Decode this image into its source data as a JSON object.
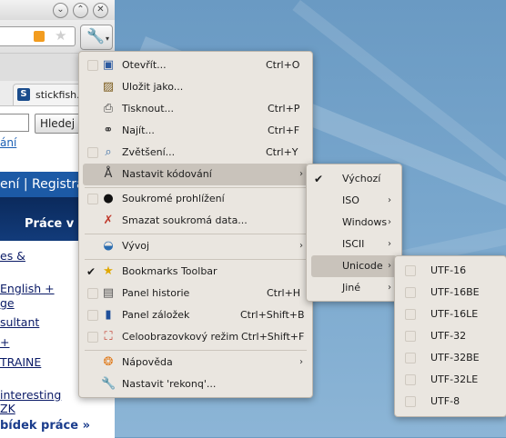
{
  "browser": {
    "tab_label": "stickfish.c",
    "tab_favicon": "S",
    "search_button": "Hledej",
    "link1": "ání",
    "band_text": "ení | Registrac",
    "dark_heading": "Práce v l",
    "jobs": [
      "es &",
      "English +",
      "ge",
      "sultant",
      "+",
      "TRAINE",
      "interesting",
      "ZK"
    ],
    "more_link": "bídek práce »"
  },
  "main_menu": {
    "items": [
      {
        "icon": "folder-open-icon",
        "label": "Otevřít...",
        "shortcut": "Ctrl+O"
      },
      {
        "icon": "save-as-icon",
        "label": "Uložit jako...",
        "shortcut": ""
      },
      {
        "icon": "printer-icon",
        "label": "Tisknout...",
        "shortcut": "Ctrl+P"
      },
      {
        "icon": "binoculars-icon",
        "label": "Najít...",
        "shortcut": "Ctrl+F"
      },
      {
        "icon": "zoom-icon",
        "label": "Zvětšení...",
        "shortcut": "Ctrl+Y"
      },
      {
        "icon": "encoding-icon",
        "label": "Nastavit kódování",
        "shortcut": ""
      },
      {
        "icon": "private-browsing-icon",
        "label": "Soukromé prohlížení",
        "shortcut": ""
      },
      {
        "icon": "clear-private-data-icon",
        "label": "Smazat soukromá data...",
        "shortcut": ""
      },
      {
        "icon": "development-icon",
        "label": "Vývoj",
        "shortcut": ""
      },
      {
        "icon": "bookmarks-toolbar-icon",
        "label": "Bookmarks Toolbar",
        "shortcut": ""
      },
      {
        "icon": "history-panel-icon",
        "label": "Panel historie",
        "shortcut": "Ctrl+H"
      },
      {
        "icon": "bookmarks-panel-icon",
        "label": "Panel záložek",
        "shortcut": "Ctrl+Shift+B"
      },
      {
        "icon": "fullscreen-icon",
        "label": "Celoobrazovkový režim",
        "shortcut": "Ctrl+Shift+F"
      },
      {
        "icon": "help-icon",
        "label": "Nápověda",
        "shortcut": ""
      },
      {
        "icon": "configure-icon",
        "label": "Nastavit 'rekonq'...",
        "shortcut": ""
      }
    ]
  },
  "encoding_menu": {
    "items": [
      "Výchozí",
      "ISO",
      "Windows",
      "ISCII",
      "Unicode",
      "Jiné"
    ]
  },
  "unicode_menu": {
    "items": [
      "UTF-16",
      "UTF-16BE",
      "UTF-16LE",
      "UTF-32",
      "UTF-32BE",
      "UTF-32LE",
      "UTF-8"
    ]
  },
  "colors": {
    "menu_bg": "#eae6e0",
    "highlight": "#c9c3bb",
    "desktop": "#6d9cc3"
  }
}
